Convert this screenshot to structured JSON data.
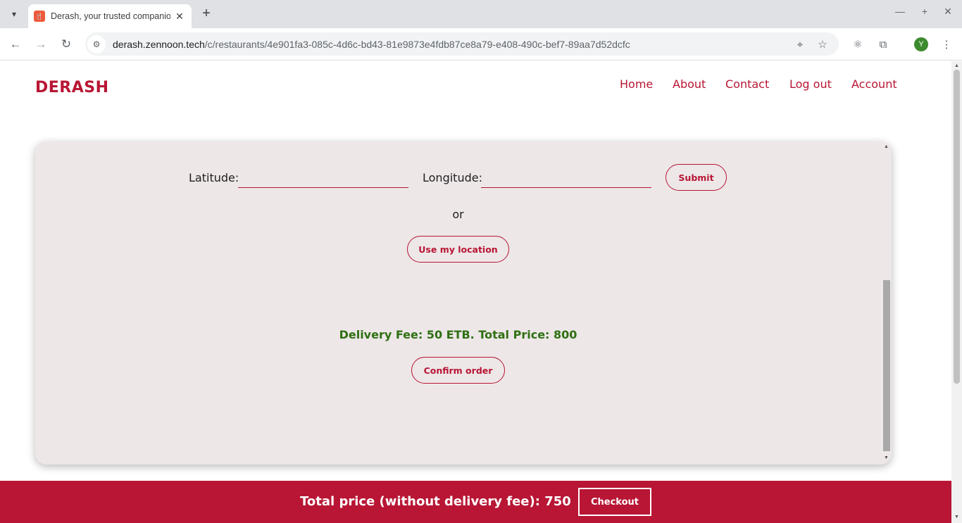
{
  "browser": {
    "tab_title": "Derash, your trusted companion",
    "favicon_glyph": "🍴",
    "new_tab_label": "+",
    "tab_close_label": "✕",
    "url_host": "derash.zennoon.tech",
    "url_path": "/c/restaurants/4e901fa3-085c-4d6c-bd43-81e9873e4fdb87ce8a79-e408-490c-bef7-89aa7d52dcfc",
    "profile_initial": "Y",
    "icons": [
      "tab-list-icon",
      "back-icon",
      "forward-icon",
      "reload-icon",
      "site-info-icon",
      "location-icon",
      "star-icon",
      "extension-react-icon",
      "extensions-icon",
      "menu-icon",
      "minimize-icon",
      "maximize-icon",
      "close-icon"
    ]
  },
  "header": {
    "logo": "DERASH",
    "nav": [
      "Home",
      "About",
      "Contact",
      "Log out",
      "Account"
    ]
  },
  "location_form": {
    "latitude_label": "Latitude:",
    "latitude_value": "",
    "longitude_label": "Longitude:",
    "longitude_value": "",
    "submit_label": "Submit",
    "or_text": "or",
    "use_location_label": "Use my location"
  },
  "order": {
    "fee_text": "Delivery Fee: 50 ETB. Total Price: 800",
    "confirm_label": "Confirm order"
  },
  "footer_bar": {
    "total_text": "Total price (without delivery fee): 750",
    "checkout_label": "Checkout"
  },
  "colors": {
    "brand": "#b81634",
    "success": "#2f6f12",
    "card_bg": "#ede7e8"
  }
}
